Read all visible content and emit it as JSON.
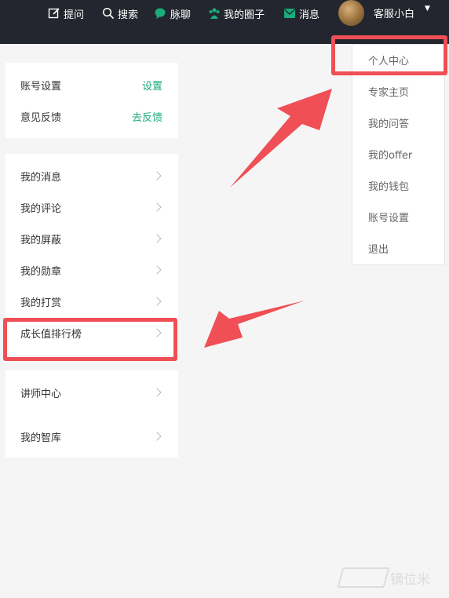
{
  "topnav": {
    "ask": "提问",
    "search": "搜索",
    "chat": "脉聊",
    "circles": "我的圈子",
    "messages": "消息",
    "username": "客服小白"
  },
  "settings_card": {
    "rows": [
      {
        "label": "账号设置",
        "action": "设置"
      },
      {
        "label": "意见反馈",
        "action": "去反馈"
      }
    ]
  },
  "menu_card": {
    "items": [
      "我的消息",
      "我的评论",
      "我的屏蔽",
      "我的勋章",
      "我的打赏",
      "成长值排行榜"
    ]
  },
  "extra_card": {
    "items": [
      "讲师中心",
      "我的智库"
    ]
  },
  "dropdown": {
    "items": [
      "个人中心",
      "专家主页",
      "我的问答",
      "我的offer",
      "我的钱包",
      "账号设置",
      "退出"
    ]
  },
  "watermark": {
    "text": "镝位米"
  },
  "colors": {
    "topbar": "#23262e",
    "accent": "#1aac7b",
    "annotation": "#ef4f55"
  }
}
